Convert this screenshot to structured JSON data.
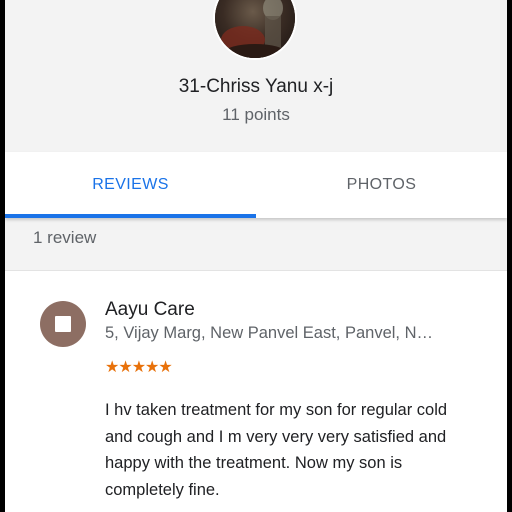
{
  "profile": {
    "name": "31-Chriss Yanu x-j",
    "points": "11 points"
  },
  "tabs": [
    {
      "label": "REVIEWS",
      "active": true
    },
    {
      "label": "PHOTOS",
      "active": false
    }
  ],
  "review_count": "1 review",
  "review": {
    "place_name": "Aayu Care",
    "place_address": "5, Vijay Marg, New Panvel East, Panvel, N…",
    "rating": 5,
    "stars": "★★★★★",
    "text": "I hv taken treatment for my son for regular cold and cough and I m very very very satisfied and happy with the treatment. Now my son is completely fine."
  },
  "colors": {
    "accent": "#1a73e8",
    "star": "#e8710a",
    "place_icon": "#8d6e63"
  },
  "icons": {
    "avatar": "profile-photo",
    "place": "place-category-icon"
  }
}
